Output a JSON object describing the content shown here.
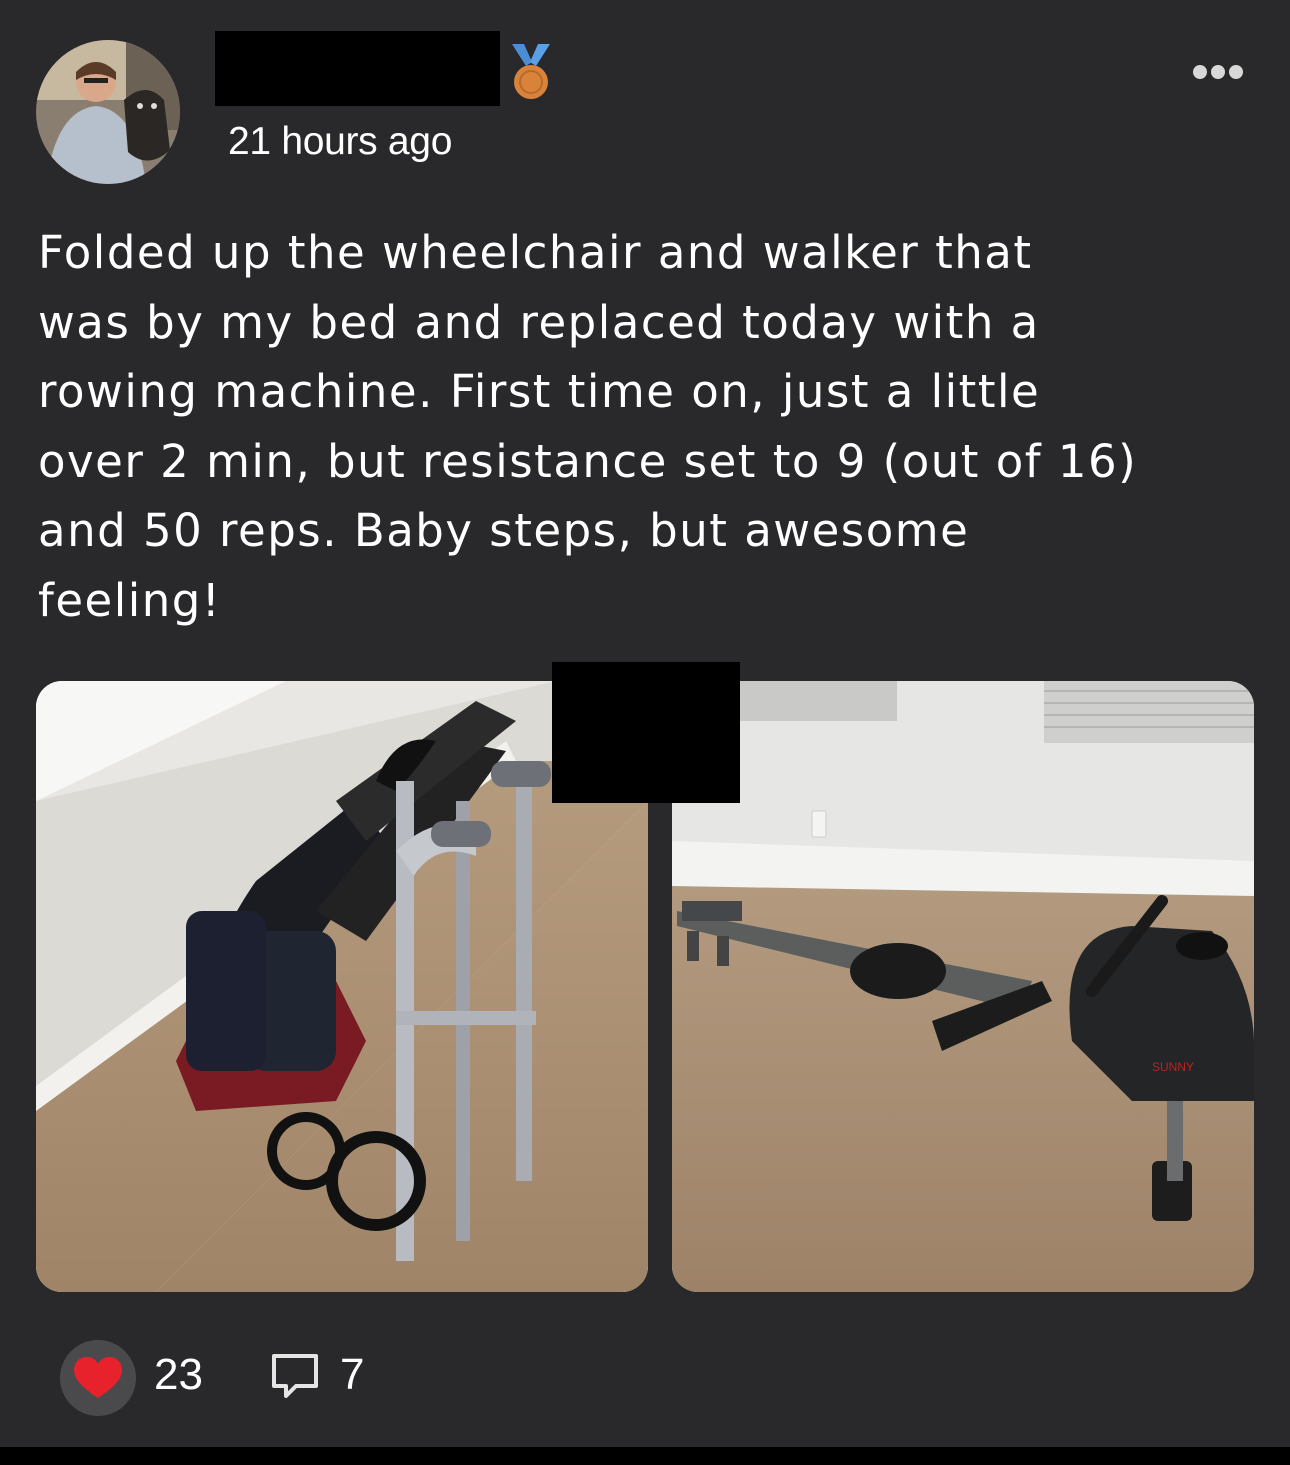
{
  "post": {
    "timestamp": "21 hours ago",
    "text_lines": [
      "Folded up the wheelchair and walker that",
      "was by my bed and replaced today with a",
      "rowing machine. First time on, just a little",
      "over 2 min, but resistance set to 9 (out of 16)",
      "and 50 reps. Baby steps, but awesome",
      "feeling!"
    ]
  },
  "reactions": {
    "likes": "23",
    "comments": "7"
  },
  "colors": {
    "background": "#29292b",
    "text": "#ffffff",
    "heart": "#e8222c",
    "medal_ribbon": "#4a8fd6",
    "medal": "#d9823a"
  },
  "icons": {
    "more": "more-dots-icon",
    "like": "heart-icon",
    "comment": "comment-icon",
    "badge": "medal-icon"
  }
}
